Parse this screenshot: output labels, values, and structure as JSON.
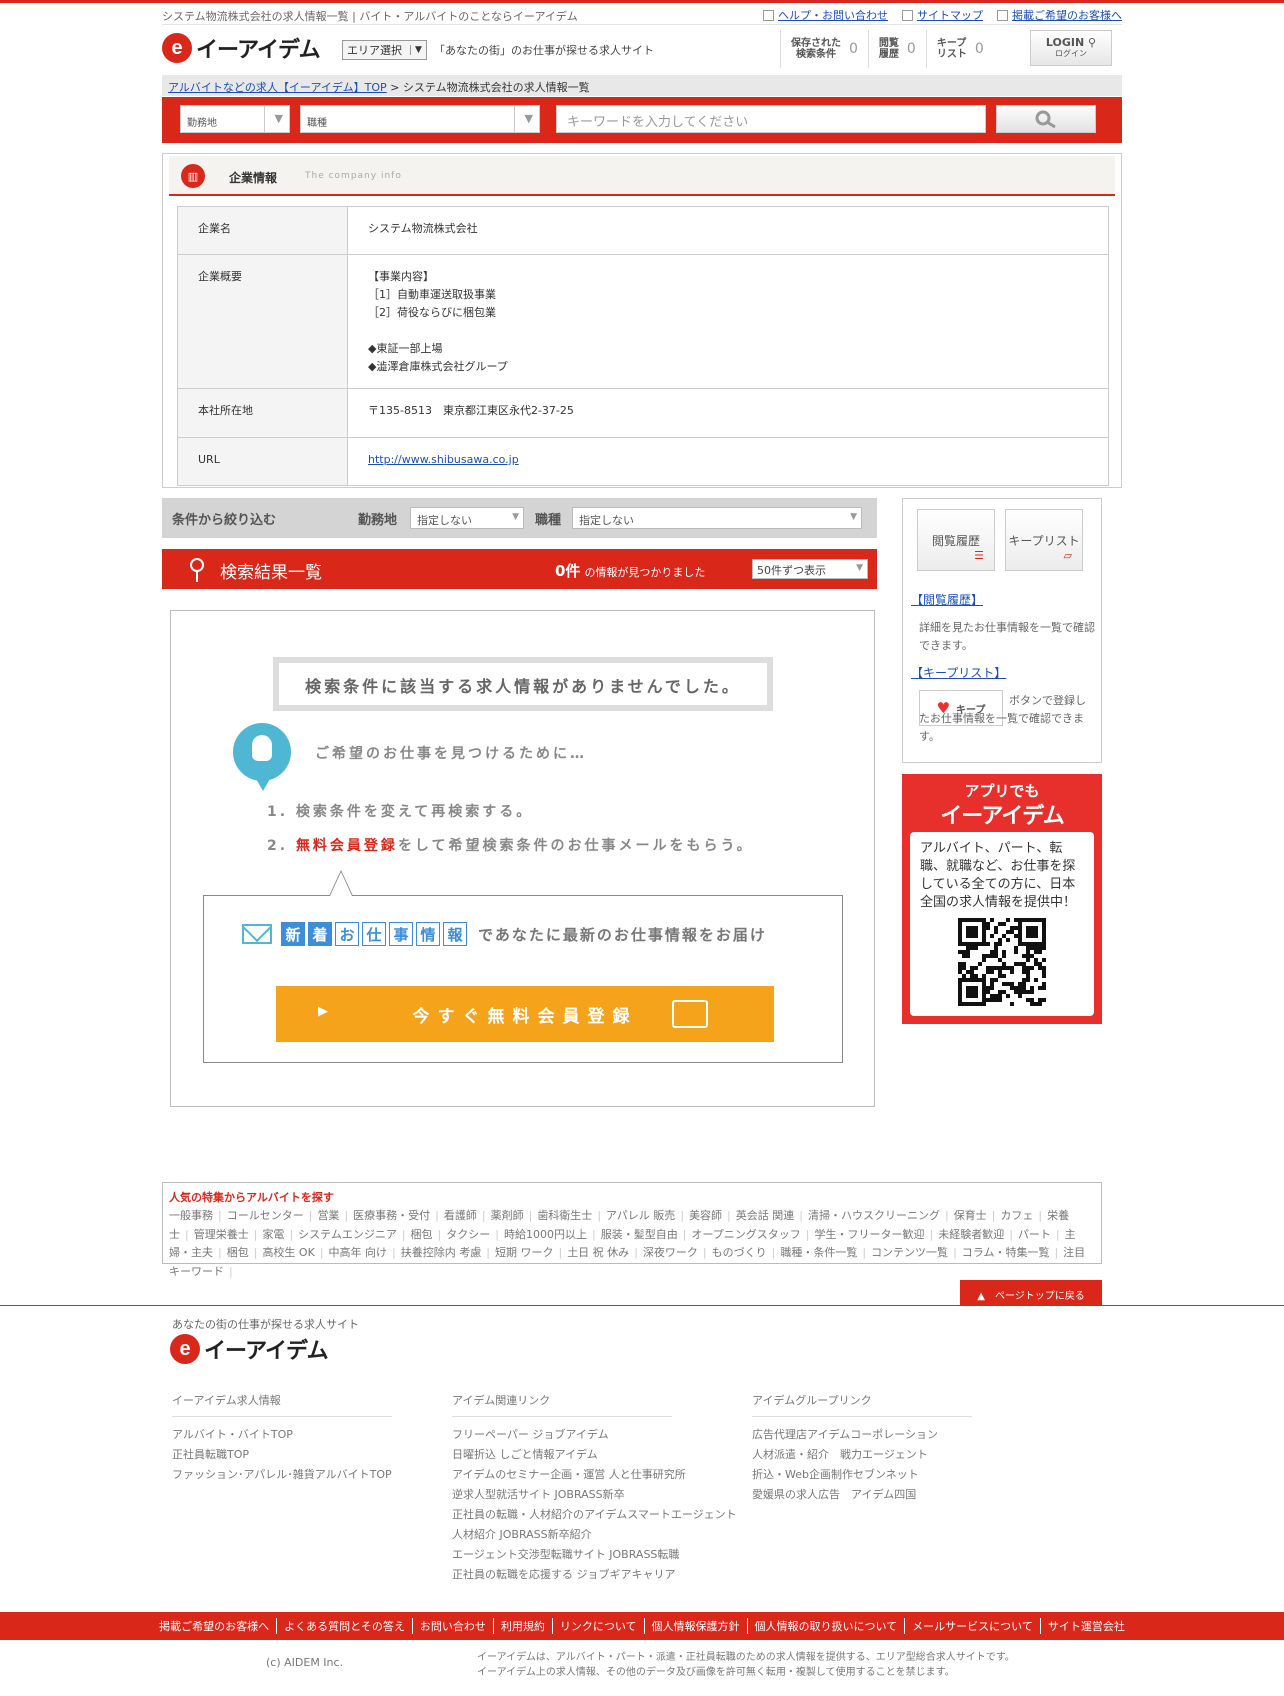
{
  "top_bar": {
    "tagline": "システム物流株式会社の求人情報一覧 | バイト・アルバイトのことならイーアイデム",
    "links": [
      "ヘルプ・お問い合わせ",
      "サイトマップ",
      "掲載ご希望のお客様へ"
    ]
  },
  "header": {
    "logo_e": "e",
    "logo_text": "イーアイデム",
    "area_select": "エリア選択",
    "catch": "「あなたの街」のお仕事が探せる求人サイト",
    "counters": [
      {
        "label": "保存された\n検索条件",
        "count": "0"
      },
      {
        "label": "閲覧\n履歴",
        "count": "0"
      },
      {
        "label": "キープ\nリスト",
        "count": "0"
      }
    ],
    "login": "LOGIN",
    "login_sub": "ログイン"
  },
  "breadcrumb": {
    "home": "アルバイトなどの求人【イーアイデム】TOP",
    "sep": " > ",
    "current": "システム物流株式会社の求人情報一覧"
  },
  "search": {
    "location": "勤務地",
    "job_type": "職種",
    "keyword_placeholder": "キーワードを入力してください"
  },
  "company": {
    "title": "企業情報",
    "subtitle": "The company info",
    "rows": [
      {
        "label": "企業名",
        "value": "システム物流株式会社"
      },
      {
        "label": "企業概要",
        "value": "【事業内容】\n［1］自動車運送取扱事業\n［2］荷役ならびに梱包業\n\n◆東証一部上場\n◆澁澤倉庫株式会社グループ"
      },
      {
        "label": "本社所在地",
        "value": "〒135-8513　東京都江東区永代2-37-25"
      },
      {
        "label": "URL",
        "value": "http://www.shibusawa.co.jp"
      }
    ]
  },
  "filter": {
    "title": "条件から絞り込む",
    "location_label": "勤務地",
    "location_value": "指定しない",
    "job_label": "職種",
    "job_value": "指定しない"
  },
  "results": {
    "title": "検索結果一覧",
    "count": "0件",
    "count_suffix": "の情報が見つかりました",
    "per_page": "50件ずつ表示"
  },
  "no_result": {
    "title": "検索条件に該当する求人情報がありませんでした。",
    "hint": "ご希望のお仕事を見つけるために…",
    "step1": "1. 検索条件を変えて再検索する。",
    "step2_prefix": "2. ",
    "step2_highlight": "無料会員登録",
    "step2_suffix": "をして希望検索条件のお仕事メールをもらう。",
    "mail_chars": [
      "新",
      "着",
      "お",
      "仕",
      "事",
      "情",
      "報"
    ],
    "mail_text": "であなたに最新のお仕事情報をお届け",
    "register_button": "今すぐ無料会員登録"
  },
  "sidebar": {
    "history_button": "閲覧履歴",
    "keep_button": "キープリスト",
    "history_link": "【閲覧履歴】",
    "history_desc": "詳細を見たお仕事情報を一覧で確認できます。",
    "keep_link": "【キープリスト】",
    "keep_btn_label": "キープ",
    "keep_desc": "ボタンで登録したお仕事情報を一覧で確認できます。",
    "app_line1": "アプリでも",
    "app_line2": "イーアイデム",
    "app_desc": "アルバイト、パート、転職、就職など、お仕事を探している全ての方に、日本全国の求人情報を提供中！"
  },
  "features": {
    "heading": "人気の特集からアルバイトを探す",
    "items": [
      "一般事務",
      "コールセンター",
      "営業",
      "医療事務・受付",
      "看護師",
      "薬剤師",
      "歯科衛生士",
      "アパレル 販売",
      "美容師",
      "英会話 関連",
      "清掃・ハウスクリーニング",
      "保育士",
      "カフェ",
      "栄養士",
      "管理栄養士",
      "家電",
      "システムエンジニア",
      "梱包",
      "タクシー",
      "時給1000円以上",
      "服装・髪型自由",
      "オープニングスタッフ",
      "学生・フリーター歓迎",
      "未経験者歓迎",
      "パート",
      "主婦・主夫",
      "梱包",
      "高校生 OK",
      "中高年 向け",
      "扶養控除内 考慮",
      "短期 ワーク",
      "土日 祝 休み",
      "深夜ワーク",
      "ものづくり",
      "職種・条件一覧",
      "コンテンツ一覧",
      "コラム・特集一覧",
      "注目キーワード"
    ]
  },
  "page_top": "ページトップに戻る",
  "footer": {
    "tagline": "あなたの街の仕事が探せる求人サイト",
    "cols": [
      {
        "heading": "イーアイデム求人情報",
        "items": [
          "アルバイト・バイトTOP",
          "正社員転職TOP",
          "ファッション･アパレル･雑貨アルバイトTOP"
        ]
      },
      {
        "heading": "アイデム関連リンク",
        "items": [
          "フリーペーパー ジョブアイデム",
          "日曜折込 しごと情報アイデム",
          "アイデムのセミナー企画・運営 人と仕事研究所",
          "逆求人型就活サイト JOBRASS新卒",
          "正社員の転職・人材紹介のアイデムスマートエージェント",
          "人材紹介 JOBRASS新卒紹介",
          "エージェント交渉型転職サイト JOBRASS転職",
          "正社員の転職を応援する ジョブギアキャリア"
        ]
      },
      {
        "heading": "アイデムグループリンク",
        "items": [
          "広告代理店アイデムコーポレーション",
          "人材派遣・紹介　戦力エージェント",
          "折込・Web企画制作セブンネット",
          "愛媛県の求人広告　アイデム四国"
        ]
      }
    ],
    "bottom_links": [
      "掲載ご希望のお客様へ",
      "よくある質問とその答え",
      "お問い合わせ",
      "利用規約",
      "リンクについて",
      "個人情報保護方針",
      "個人情報の取り扱いについて",
      "メールサービスについて",
      "サイト運営会社"
    ],
    "copyright": "(c) AIDEM Inc.",
    "disclaimer1": "イーアイデムは、アルバイト・パート・派遣・正社員転職のための求人情報を提供する、エリア型総合求人サイトです。",
    "disclaimer2": "イーアイデム上の求人情報、その他のデータ及び画像を許可無く転用・複製して使用することを禁じます。"
  },
  "colors": {
    "brand_red": "#d9281a",
    "accent_orange": "#f5a31a",
    "accent_blue": "#3d8ed8"
  }
}
